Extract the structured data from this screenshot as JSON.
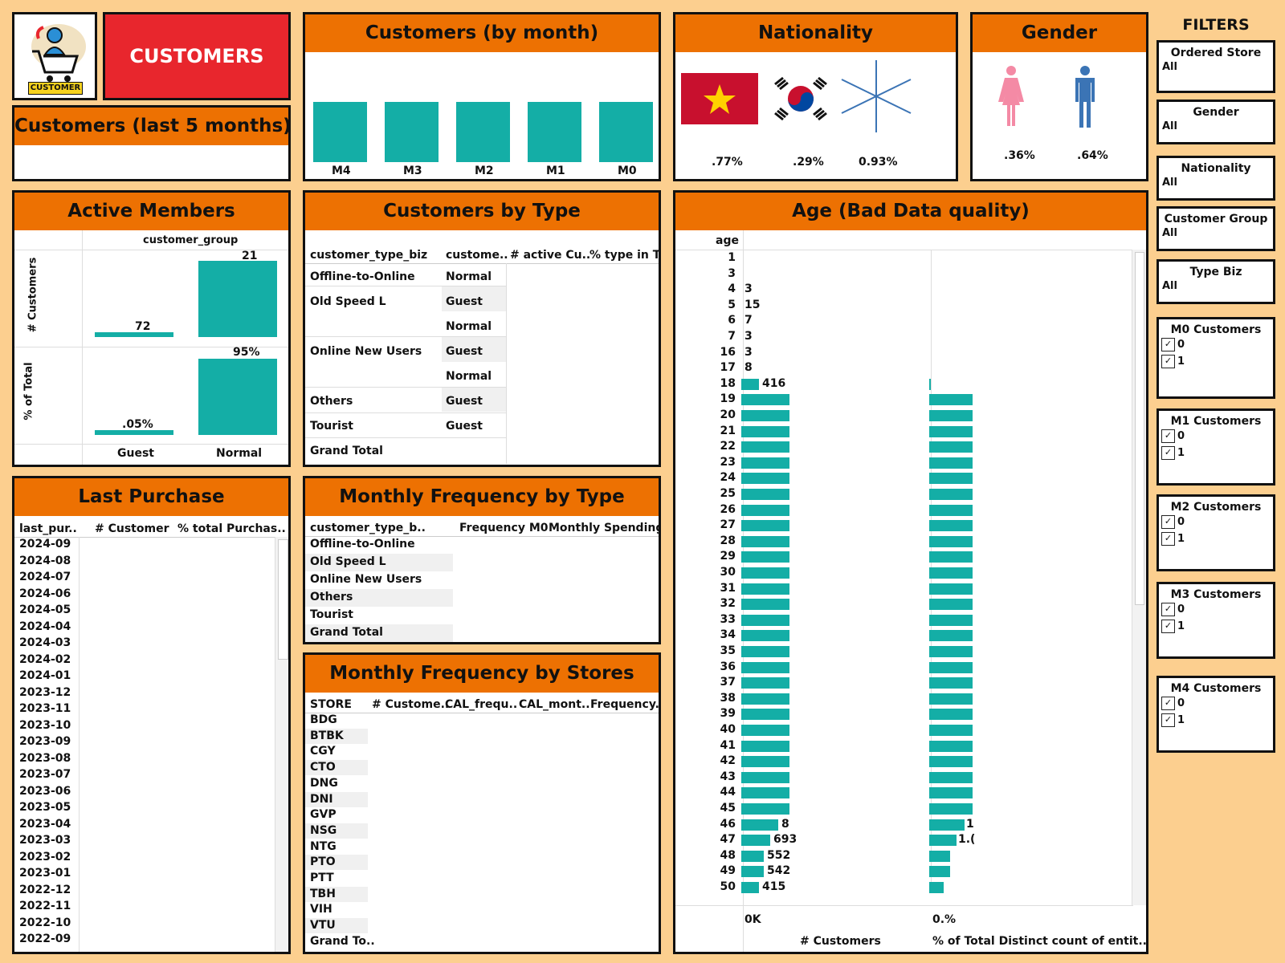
{
  "logo": {
    "text": "CUSTOMER"
  },
  "header": {
    "title": "CUSTOMERS"
  },
  "last5": {
    "title": "Customers (last 5 months)"
  },
  "by_month": {
    "title": "Customers (by month)",
    "labels": [
      "M4",
      "M3",
      "M2",
      "M1",
      "M0"
    ]
  },
  "nationality": {
    "title": "Nationality",
    "items": [
      {
        "icon": "vietnam-flag-icon",
        "pct": ".77%"
      },
      {
        "icon": "korea-flag-icon",
        "pct": ".29%"
      },
      {
        "icon": "asterisk-icon",
        "pct": "0.93%"
      }
    ]
  },
  "gender": {
    "title": "Gender",
    "items": [
      {
        "icon": "female-icon",
        "pct": ".36%",
        "color": "#f48aa5"
      },
      {
        "icon": "male-icon",
        "pct": ".64%",
        "color": "#3b74b5"
      }
    ]
  },
  "active": {
    "title": "Active Members",
    "header": "customer_group",
    "ylabel_top": "# Customers",
    "ylabel_bottom": "% of Total",
    "categories": [
      "Guest",
      "Normal"
    ],
    "top_labels": [
      "72",
      "21"
    ],
    "bottom_labels": [
      ".05%",
      "95%"
    ],
    "top_fill": [
      0.06,
      1.0
    ],
    "bottom_fill": [
      0.06,
      1.0
    ]
  },
  "by_type": {
    "title": "Customers by Type",
    "headers": [
      "customer_type_biz",
      "custome..",
      "# active Cu..",
      "% type in T.."
    ],
    "rows": [
      {
        "type": "Offline-to-Online",
        "group": "Normal"
      },
      {
        "type": "Old Speed L",
        "group": "Guest"
      },
      {
        "type": "",
        "group": "Normal"
      },
      {
        "type": "Online New Users",
        "group": "Guest"
      },
      {
        "type": "",
        "group": "Normal"
      },
      {
        "type": "Others",
        "group": "Guest"
      },
      {
        "type": "Tourist",
        "group": "Guest"
      },
      {
        "type": "Grand Total",
        "group": ""
      }
    ]
  },
  "age": {
    "title": "Age (Bad Data quality)",
    "col_header": "age",
    "xlabel_left": "# Customers",
    "xlabel_right": "% of Total Distinct count of entit..",
    "tick_left": "0K",
    "tick_right": "0.%",
    "rows": [
      {
        "age": "1",
        "label": ""
      },
      {
        "age": "3",
        "label": ""
      },
      {
        "age": "4",
        "label": "3"
      },
      {
        "age": "5",
        "label": "15"
      },
      {
        "age": "6",
        "label": "7"
      },
      {
        "age": "7",
        "label": "3"
      },
      {
        "age": "16",
        "label": "3"
      },
      {
        "age": "17",
        "label": "8"
      },
      {
        "age": "18",
        "label": "416"
      },
      {
        "age": "19",
        "label": ""
      },
      {
        "age": "20",
        "label": ""
      },
      {
        "age": "21",
        "label": ""
      },
      {
        "age": "22",
        "label": ""
      },
      {
        "age": "23",
        "label": ""
      },
      {
        "age": "24",
        "label": ""
      },
      {
        "age": "25",
        "label": ""
      },
      {
        "age": "26",
        "label": ""
      },
      {
        "age": "27",
        "label": ""
      },
      {
        "age": "28",
        "label": ""
      },
      {
        "age": "29",
        "label": ""
      },
      {
        "age": "30",
        "label": ""
      },
      {
        "age": "31",
        "label": ""
      },
      {
        "age": "32",
        "label": ""
      },
      {
        "age": "33",
        "label": ""
      },
      {
        "age": "34",
        "label": ""
      },
      {
        "age": "35",
        "label": ""
      },
      {
        "age": "36",
        "label": ""
      },
      {
        "age": "37",
        "label": ""
      },
      {
        "age": "38",
        "label": ""
      },
      {
        "age": "39",
        "label": ""
      },
      {
        "age": "40",
        "label": ""
      },
      {
        "age": "41",
        "label": ""
      },
      {
        "age": "42",
        "label": ""
      },
      {
        "age": "43",
        "label": ""
      },
      {
        "age": "44",
        "label": ""
      },
      {
        "age": "45",
        "label": ""
      },
      {
        "age": "46",
        "label": "8"
      },
      {
        "age": "47",
        "label": "693"
      },
      {
        "age": "48",
        "label": "552"
      },
      {
        "age": "49",
        "label": "542"
      },
      {
        "age": "50",
        "label": "415"
      }
    ],
    "right_labels": {
      "46": "1",
      "47": "1.("
    }
  },
  "last_purchase": {
    "title": "Last Purchase",
    "headers": [
      "last_pur..",
      "# Customer",
      "% total Purchas.."
    ],
    "months": [
      "2024-09",
      "2024-08",
      "2024-07",
      "2024-06",
      "2024-05",
      "2024-04",
      "2024-03",
      "2024-02",
      "2024-01",
      "2023-12",
      "2023-11",
      "2023-10",
      "2023-09",
      "2023-08",
      "2023-07",
      "2023-06",
      "2023-05",
      "2023-04",
      "2023-03",
      "2023-02",
      "2023-01",
      "2022-12",
      "2022-11",
      "2022-10",
      "2022-09"
    ]
  },
  "freq_type": {
    "title": "Monthly Frequency by Type",
    "headers": [
      "customer_type_b..",
      "Frequency M0",
      "Monthly Spending .."
    ],
    "rows": [
      "Offline-to-Online",
      "Old Speed L",
      "Online New Users",
      "Others",
      "Tourist",
      "Grand Total"
    ]
  },
  "freq_store": {
    "title": "Monthly Frequency by Stores",
    "headers": [
      "STORE",
      "# Custome..",
      "CAL_frequ..",
      "CAL_mont..",
      "Frequency.."
    ],
    "rows": [
      "BDG",
      "BTBK",
      "CGY",
      "CTO",
      "DNG",
      "DNI",
      "GVP",
      "NSG",
      "NTG",
      "PTO",
      "PTT",
      "TBH",
      "VIH",
      "VTU",
      "Grand To.."
    ]
  },
  "filters": {
    "title": "FILTERS",
    "dropdowns": [
      {
        "label": "Ordered Store",
        "value": "All"
      },
      {
        "label": "Gender",
        "value": "All"
      },
      {
        "label": "Nationality",
        "value": "All"
      },
      {
        "label": "Customer Group",
        "value": "All"
      },
      {
        "label": "Type Biz",
        "value": "All"
      }
    ],
    "checks": [
      {
        "label": "M0 Customers",
        "options": [
          "0",
          "1"
        ]
      },
      {
        "label": "M1 Customers",
        "options": [
          "0",
          "1"
        ]
      },
      {
        "label": "M2 Customers",
        "options": [
          "0",
          "1"
        ]
      },
      {
        "label": "M3 Customers",
        "options": [
          "0",
          "1"
        ]
      },
      {
        "label": "M4 Customers",
        "options": [
          "0",
          "1"
        ]
      }
    ]
  },
  "colors": {
    "accent": "#ed7102",
    "bar": "#14aea6",
    "red": "#e8262d",
    "background": "#fccf8f"
  }
}
